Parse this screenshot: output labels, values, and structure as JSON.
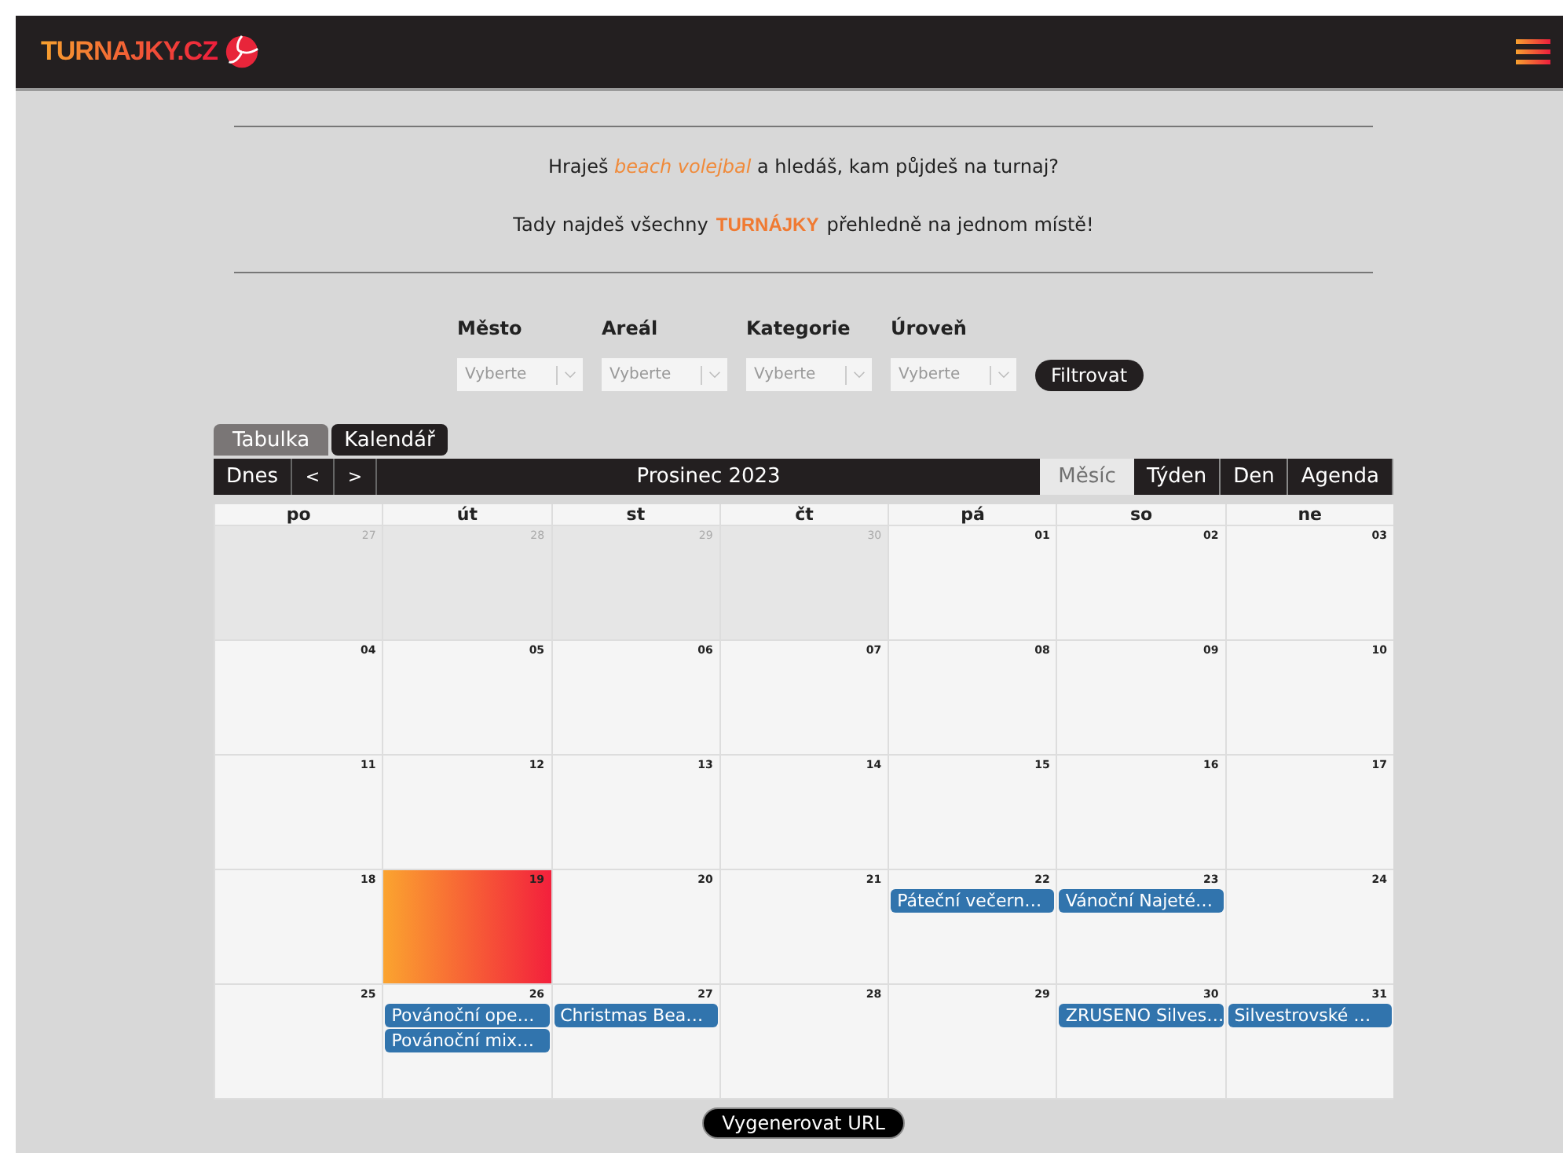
{
  "header": {
    "logo": "TURNAJKY.CZ"
  },
  "intro": {
    "line1": "Hraješ *beach volejbal* a hledáš, kam půjdeš na turnaj?",
    "line2_before": "Tady najdeš všechny",
    "line2_brand": "TURNÁJKY",
    "line2_after": "přehledně na jednom místě!"
  },
  "filters": [
    {
      "label": "Město",
      "placeholder": "Vyberte"
    },
    {
      "label": "Areál",
      "placeholder": "Vyberte"
    },
    {
      "label": "Kategorie",
      "placeholder": "Vyberte"
    },
    {
      "label": "Úroveň",
      "placeholder": "Vyberte"
    }
  ],
  "filter_button": "Filtrovat",
  "tabs": [
    {
      "label": "Tabulka",
      "selected": false
    },
    {
      "label": "Kalendář",
      "selected": true
    }
  ],
  "toolbar": {
    "today": "Dnes",
    "prev": "<",
    "next": ">",
    "title": "Prosinec 2023"
  },
  "views": [
    {
      "label": "Měsíc",
      "selected": true
    },
    {
      "label": "Týden",
      "selected": false
    },
    {
      "label": "Den",
      "selected": false
    },
    {
      "label": "Agenda",
      "selected": false
    }
  ],
  "weekdays": [
    "po",
    "út",
    "st",
    "čt",
    "pá",
    "so",
    "ne"
  ],
  "weeks": [
    [
      {
        "day": "27",
        "other_month": true
      },
      {
        "day": "28",
        "other_month": true
      },
      {
        "day": "29",
        "other_month": true
      },
      {
        "day": "30",
        "other_month": true
      },
      {
        "day": "01"
      },
      {
        "day": "02"
      },
      {
        "day": "03"
      }
    ],
    [
      {
        "day": "04"
      },
      {
        "day": "05"
      },
      {
        "day": "06"
      },
      {
        "day": "07"
      },
      {
        "day": "08"
      },
      {
        "day": "09"
      },
      {
        "day": "10"
      }
    ],
    [
      {
        "day": "11"
      },
      {
        "day": "12"
      },
      {
        "day": "13"
      },
      {
        "day": "14"
      },
      {
        "day": "15"
      },
      {
        "day": "16"
      },
      {
        "day": "17"
      }
    ],
    [
      {
        "day": "18"
      },
      {
        "day": "19",
        "today": true
      },
      {
        "day": "20"
      },
      {
        "day": "21"
      },
      {
        "day": "22",
        "events": [
          "Páteční večern…"
        ]
      },
      {
        "day": "23",
        "events": [
          "Vánoční Najeté…"
        ]
      },
      {
        "day": "24"
      }
    ],
    [
      {
        "day": "25"
      },
      {
        "day": "26",
        "events": [
          "Povánoční ope…",
          "Povánoční mix…"
        ]
      },
      {
        "day": "27",
        "events": [
          "Christmas Bea…"
        ]
      },
      {
        "day": "28"
      },
      {
        "day": "29"
      },
      {
        "day": "30",
        "events": [
          "ZRUSENO Silves…"
        ]
      },
      {
        "day": "31",
        "events": [
          "Silvestrovské …"
        ]
      }
    ]
  ],
  "url_button": "Vygenerovat URL"
}
